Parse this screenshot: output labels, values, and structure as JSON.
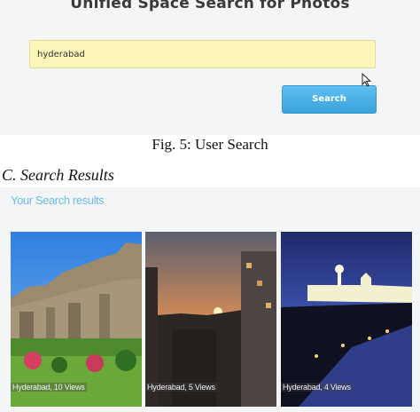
{
  "app": {
    "title": "Unified Space Search for Photos"
  },
  "search": {
    "value": "hyderabad",
    "button_label": "Search"
  },
  "figure_caption": "Fig. 5: User Search",
  "section": {
    "heading": "C.   Search Results"
  },
  "results": {
    "title": "Your Search results",
    "items": [
      {
        "caption": "Hyderabad, 10 Views"
      },
      {
        "caption": "Hyderabad, 5 Views"
      },
      {
        "caption": "Hyderabad, 4 Views"
      }
    ]
  }
}
